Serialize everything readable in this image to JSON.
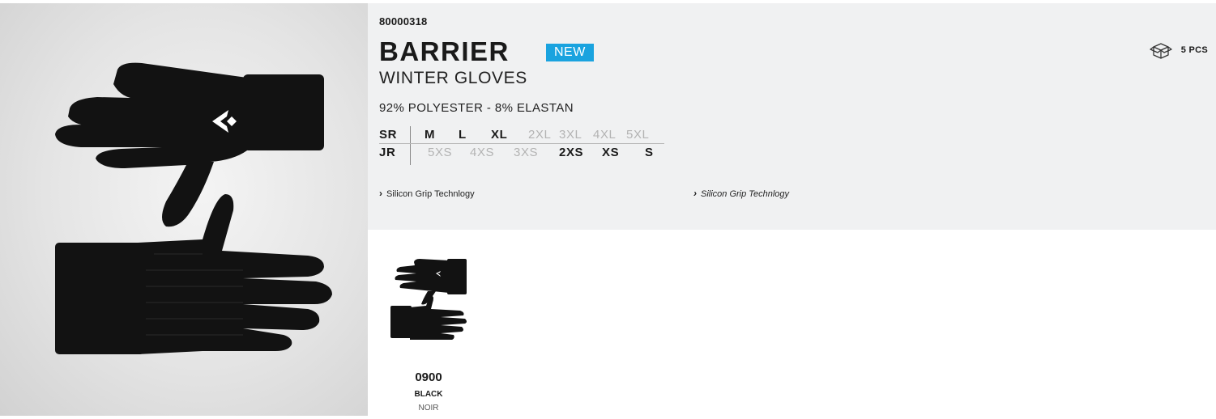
{
  "product": {
    "sku": "80000318",
    "name": "BARRIER",
    "badge": "NEW",
    "subtitle": "WINTER GLOVES",
    "material": "92% POLYESTER - 8% ELASTAN",
    "pack_quantity": "5 PCS",
    "pack_icon": "box-icon"
  },
  "sizes": {
    "senior": {
      "label": "SR",
      "items": [
        {
          "label": "M",
          "available": true
        },
        {
          "label": "L",
          "available": true
        },
        {
          "label": "XL",
          "available": true
        },
        {
          "label": "2XL",
          "available": false
        },
        {
          "label": "3XL",
          "available": false
        },
        {
          "label": "4XL",
          "available": false
        },
        {
          "label": "5XL",
          "available": false
        }
      ]
    },
    "junior": {
      "label": "JR",
      "items": [
        {
          "label": "5XS",
          "available": false
        },
        {
          "label": "4XS",
          "available": false
        },
        {
          "label": "3XS",
          "available": false
        },
        {
          "label": "2XS",
          "available": true
        },
        {
          "label": "XS",
          "available": true
        },
        {
          "label": "S",
          "available": true
        }
      ]
    }
  },
  "features": [
    {
      "text": "Silicon Grip Technlogy"
    },
    {
      "text": "Silicon Grip Technlogy"
    }
  ],
  "variants": [
    {
      "code": "0900",
      "color_en": "BLACK",
      "color_fr": "NOIR"
    }
  ],
  "colors": {
    "accent": "#1aa3df",
    "panel_bg": "#f0f1f2",
    "glove": "#121212"
  }
}
